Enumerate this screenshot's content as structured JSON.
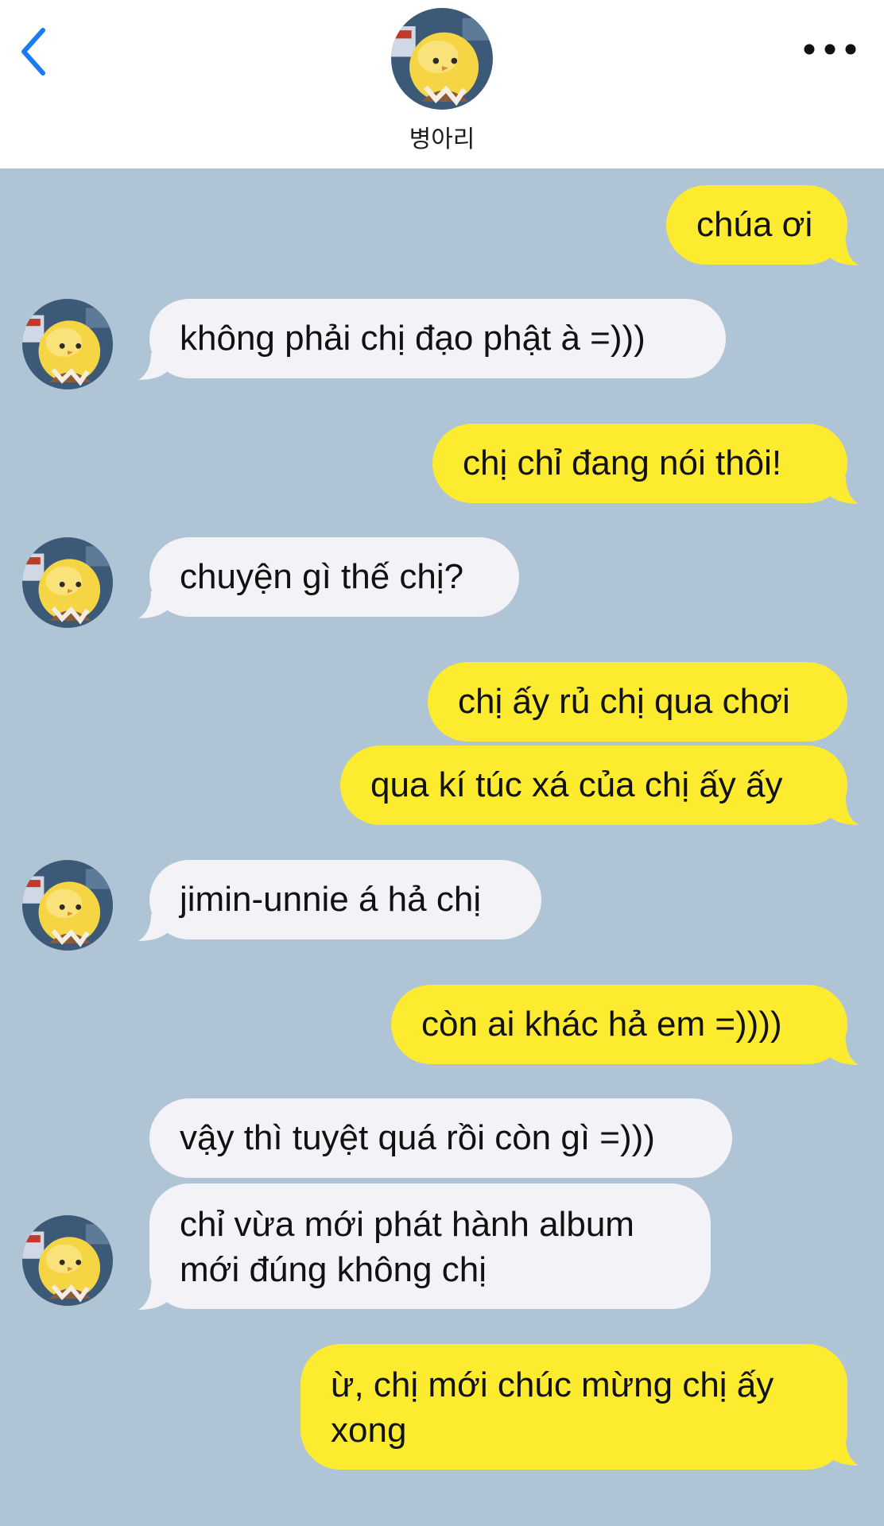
{
  "header": {
    "contact_name": "병아리",
    "back_icon": "chevron-left-icon",
    "more_icon": "ellipsis-icon",
    "accent_color": "#1a7cf2"
  },
  "colors": {
    "background": "#afc4d5",
    "sent_bubble": "#fdeb2f",
    "received_bubble": "#f2f2f7"
  },
  "messages": [
    {
      "from": "me",
      "text": "chúa ơi"
    },
    {
      "from": "contact",
      "text": "không phải chị đạo phật à =)))"
    },
    {
      "from": "me",
      "text": "chị chỉ đang nói thôi!"
    },
    {
      "from": "contact",
      "text": "chuyện gì thế chị?"
    },
    {
      "from": "me",
      "text": "chị ấy rủ chị qua chơi"
    },
    {
      "from": "me",
      "text": "qua kí túc xá của chị ấy ấy"
    },
    {
      "from": "contact",
      "text": "jimin-unnie á hả chị"
    },
    {
      "from": "me",
      "text": "còn ai khác hả em =))))"
    },
    {
      "from": "contact",
      "text": "vậy thì tuyệt quá rồi còn gì =)))"
    },
    {
      "from": "contact",
      "text": "chỉ vừa mới phát hành album mới đúng không chị"
    },
    {
      "from": "me",
      "text": "ừ, chị mới chúc mừng chị ấy xong"
    }
  ]
}
